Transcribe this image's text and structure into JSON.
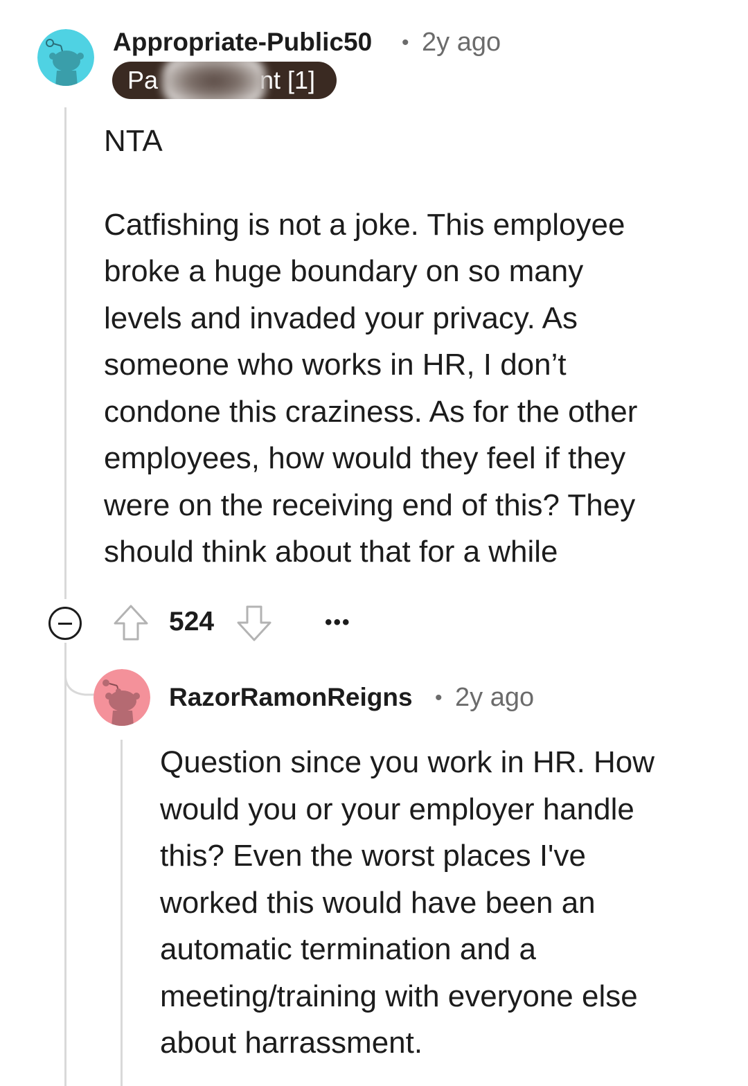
{
  "comment1": {
    "username": "Appropriate-Public50",
    "separator": "•",
    "age": "2y ago",
    "flair_prefix": "Pa",
    "flair_suffix": "nt [1]",
    "avatar_color": "#4fd2e3",
    "body": [
      "NTA",
      "Catfishing is not a joke. This employee\nbroke a huge boundary on so many\nlevels and invaded your privacy. As\nsomeone who works in HR, I don’t\ncondone this craziness. As for the other\nemployees, how would they feel if they\nwere on the receiving end of this? They\nshould think about that for a while"
    ],
    "score": "524",
    "more_label": "•••",
    "icons": {
      "collapse": "collapse-minus-icon",
      "upvote": "upvote-arrow-icon",
      "downvote": "downvote-arrow-icon"
    }
  },
  "comment2": {
    "username": "RazorRamonReigns",
    "separator": "•",
    "age": "2y ago",
    "avatar_color": "#f4919a",
    "body": "Question since you work in HR. How\nwould you or your employer handle\nthis? Even the worst places I've\nworked this would have been an\nautomatic termination and a\nmeeting/training with everyone else\nabout harrassment."
  },
  "colors": {
    "text": "#1c1c1c",
    "meta": "#6b6b6b",
    "flair_bg": "#3a2a22",
    "thread_line": "#d9d9d9"
  }
}
